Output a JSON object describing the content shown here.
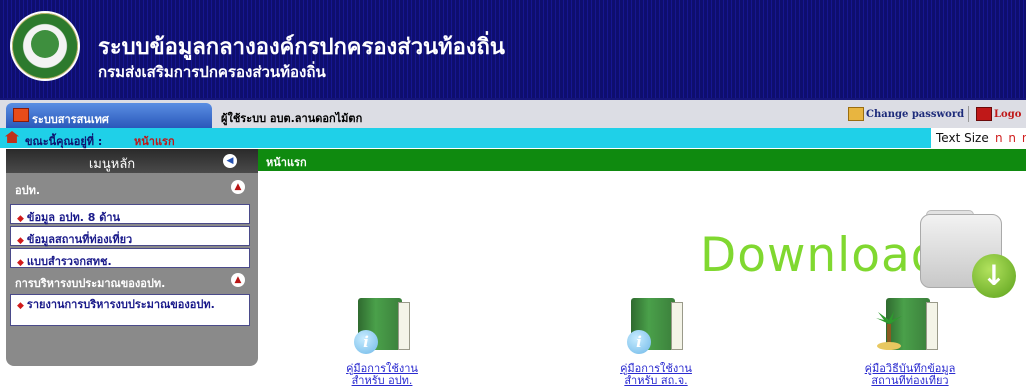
{
  "header": {
    "title": "ระบบข้อมูลกลางองค์กรปกครองส่วนท้องถิ่น",
    "subtitle": "กรมส่งเสริมการปกครองส่วนท้องถิ่น",
    "logo_icon": "department-seal-icon"
  },
  "topbar": {
    "tab_label": "ระบบสารสนเทศ",
    "user_text": "ผู้ใช้ระบบ อบต.ลานดอกไม้ตก",
    "change_password": "Change password",
    "logout": "Logo"
  },
  "breadcrumb": {
    "label": "ขณะนี้คุณอยู่ที่ :",
    "current": "หน้าแรก",
    "text_size_label": "Text Size",
    "text_size_options": "n n n"
  },
  "sidebar": {
    "title": "เมนูหลัก",
    "sections": [
      {
        "label": "อปท.",
        "items": [
          "ข้อมูล อปท. 8 ด้าน",
          "ข้อมูลสถานที่ท่องเที่ยว",
          "แบบสำรวจกสทช."
        ]
      },
      {
        "label": "การบริหารงบประมาณของอปท.",
        "items": [
          "รายงานการบริหารงบประมาณของอปท."
        ]
      }
    ]
  },
  "content": {
    "title": "หน้าแรก",
    "download_text": "Download",
    "downloads": [
      {
        "line1": "คู่มือการใช้งาน",
        "line2": "สำหรับ อปท.",
        "icon": "manual-book-icon"
      },
      {
        "line1": "คู่มือการใช้งาน",
        "line2": "สำหรับ สถ.จ.",
        "icon": "manual-book-icon"
      },
      {
        "line1": "คู่มือวิธีบันทึกข้อมูล",
        "line2": "สถานที่ท่องเที่ยว",
        "icon": "tourism-book-icon"
      }
    ]
  },
  "colors": {
    "banner": "#0e0e6e",
    "breadcrumb_bar": "#1fd0e8",
    "content_bar": "#0f8a0f",
    "sidebar": "#8a8a8a",
    "download_green": "#80d830"
  }
}
